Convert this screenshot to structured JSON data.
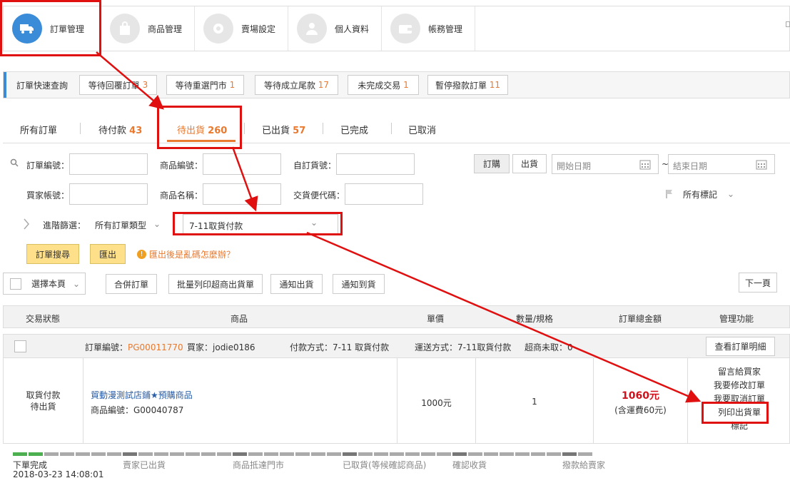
{
  "nav": {
    "items": [
      {
        "label": "訂單管理"
      },
      {
        "label": "商品管理"
      },
      {
        "label": "賣場設定"
      },
      {
        "label": "個人資料"
      },
      {
        "label": "帳務管理"
      }
    ]
  },
  "quick": {
    "title": "訂單快速查詢",
    "buttons": [
      {
        "label": "等待回覆訂單",
        "count": "3"
      },
      {
        "label": "等待重選門市",
        "count": "1"
      },
      {
        "label": "等待成立尾款",
        "count": "17"
      },
      {
        "label": "未完成交易",
        "count": "1"
      },
      {
        "label": "暫停撥款訂單",
        "count": "11"
      }
    ]
  },
  "tabs": [
    {
      "label": "所有訂單",
      "count": ""
    },
    {
      "label": "待付款",
      "count": "43"
    },
    {
      "label": "待出貨",
      "count": "260"
    },
    {
      "label": "已出貨",
      "count": "57"
    },
    {
      "label": "已完成",
      "count": ""
    },
    {
      "label": "已取消",
      "count": ""
    }
  ],
  "filters": {
    "order_no": "訂單編號：",
    "product_no": "商品編號：",
    "custom_no": "自訂貨號：",
    "buyer": "買家帳號：",
    "product_name": "商品名稱：",
    "delivery_code": "交貨便代碼：",
    "order_btn": "訂購",
    "ship_btn": "出貨",
    "start_date": "開始日期",
    "tilde": "~",
    "end_date": "結束日期",
    "all_marks": "所有標記",
    "advanced": "進階篩選：",
    "order_type": "所有訂單類型",
    "payment_type": "7-11取貨付款",
    "search_btn": "訂單搜尋",
    "export_btn": "匯出",
    "garbled_help": "匯出後是亂碼怎麼辦？"
  },
  "toolbar": {
    "select_page": "選擇本頁",
    "merge": "合併訂單",
    "batch_print": "批量列印超商出貨單",
    "notify_ship": "通知出貨",
    "notify_arrive": "通知到貨",
    "next_page": "下一頁"
  },
  "table": {
    "headers": [
      "交易狀態",
      "商品",
      "單價",
      "數量/規格",
      "訂單總金額",
      "管理功能"
    ]
  },
  "order": {
    "order_no_label": "訂單編號：",
    "order_no": "PG00011770",
    "buyer_label": "買家：",
    "buyer": "jodie0186",
    "payment_label": "付款方式：",
    "payment": "7-11 取貨付款",
    "shipping_label": "運送方式：",
    "shipping": "7-11取貨付款",
    "pickup_label": "超商未取：",
    "pickup": "0",
    "detail_btn": "查看訂單明細",
    "status_line1": "取貨付款",
    "status_line2": "待出貨",
    "product_name": "貿動漫測試店鋪★預購商品",
    "product_code": "商品編號：G00040787",
    "unit_price": "1000元",
    "quantity": "1",
    "total": "1060元",
    "shipping_fee": "(含運費60元)",
    "actions": [
      "留言給買家",
      "我要修改訂單",
      "我要取消訂單",
      "列印出貨單",
      "標記"
    ]
  },
  "progress": {
    "steps": [
      "下單完成",
      "賣家已出貨",
      "商品抵達門市",
      "已取貨(等候確認商品)",
      "確認收貨",
      "撥款給賣家"
    ],
    "timestamp": "2018-03-23 14:08:01",
    "done_fraction": 0.05
  },
  "colors": {
    "accent": "#3a8bd8",
    "orange": "#e8792f",
    "annotation_red": "#e01010",
    "total_red": "#d0101a"
  }
}
